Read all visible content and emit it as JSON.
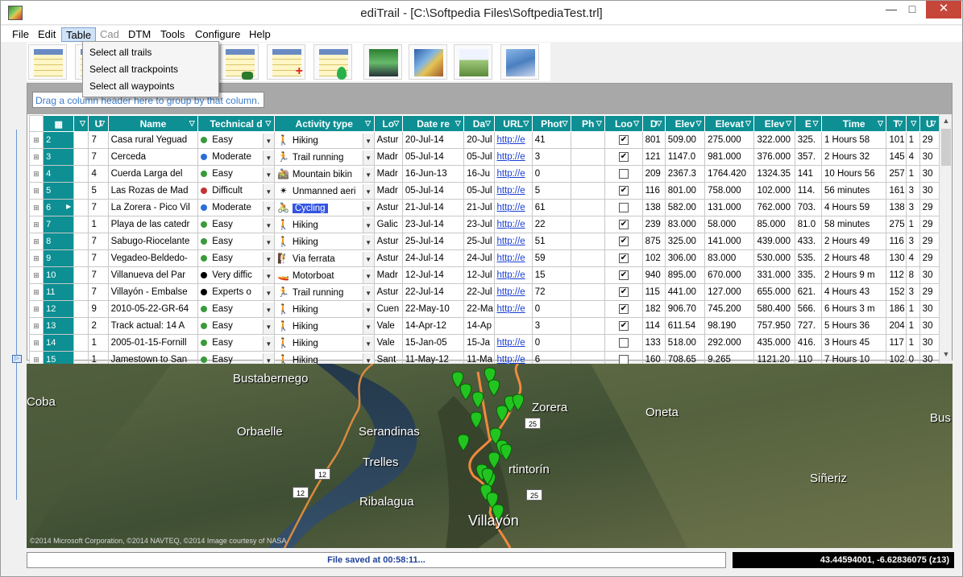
{
  "window": {
    "title": "ediTrail - [C:\\Softpedia Files\\SoftpediaTest.trl]",
    "min_label": "—",
    "max_label": "□",
    "close_label": "✕"
  },
  "menu": {
    "items": [
      {
        "label": "File",
        "state": "normal"
      },
      {
        "label": "Edit",
        "state": "normal"
      },
      {
        "label": "Table",
        "state": "open"
      },
      {
        "label": "Cad",
        "state": "disabled"
      },
      {
        "label": "DTM",
        "state": "normal"
      },
      {
        "label": "Tools",
        "state": "normal"
      },
      {
        "label": "Configure",
        "state": "normal"
      },
      {
        "label": "Help",
        "state": "normal"
      }
    ],
    "table_dropdown": [
      "Select all trails",
      "Select all trackpoints",
      "Select all waypoints"
    ]
  },
  "toolbar": {
    "buttons": [
      {
        "icon": "save-grid-icon"
      },
      {
        "icon": "table-grid-icon"
      },
      {
        "icon": "trail-grid-icon"
      },
      {
        "icon": "add-row-icon",
        "mark": "+"
      },
      {
        "icon": "waypoint-grid-icon"
      },
      {
        "icon": "gps-device-icon"
      },
      {
        "icon": "photos-icon"
      },
      {
        "icon": "elevation-profile-icon"
      },
      {
        "icon": "map-layers-icon"
      }
    ]
  },
  "grid": {
    "group_hint": "Drag a column header here to group by that column.",
    "columns": [
      "",
      "U",
      "Name",
      "Technical d",
      "Activity type",
      "Lo",
      "Date re",
      "Da",
      "URL",
      "Phot",
      "Ph",
      "Loo",
      "D",
      "Elev",
      "Elevat",
      "Elev",
      "E",
      "Time",
      "T",
      "",
      "U"
    ],
    "rows": [
      {
        "id": "2",
        "u": "7",
        "name": "Casa rural Yeguad",
        "tech": "Easy",
        "tech_color": "#3a9a3a",
        "act": "Hiking",
        "act_icon": "🚶",
        "loc": "Astur",
        "date": "20-Jul-14",
        "da": "20-Jul",
        "url": "http://e",
        "phot": "41",
        "ph": "",
        "loop": true,
        "d": "801",
        "elev1": "509.00",
        "elev2": "275.000",
        "elev3": "322.000",
        "e": "325.",
        "time": "1 Hours 58",
        "t": "101",
        "x": "1",
        "u2": "29"
      },
      {
        "id": "3",
        "u": "7",
        "name": "Cerceda",
        "tech": "Moderate",
        "tech_color": "#2b6fd6",
        "act": "Trail running",
        "act_icon": "🏃",
        "loc": "Madr",
        "date": "05-Jul-14",
        "da": "05-Jul",
        "url": "http://e",
        "phot": "3",
        "ph": "",
        "loop": true,
        "d": "121",
        "elev1": "1147.0",
        "elev2": "981.000",
        "elev3": "376.000",
        "e": "357.",
        "time": "2 Hours 32",
        "t": "145",
        "x": "4",
        "u2": "30"
      },
      {
        "id": "4",
        "u": "4",
        "name": "Cuerda Larga del",
        "tech": "Easy",
        "tech_color": "#3a9a3a",
        "act": "Mountain bikin",
        "act_icon": "🚵",
        "loc": "Madr",
        "date": "16-Jun-13",
        "da": "16-Ju",
        "url": "http://e",
        "phot": "0",
        "ph": "",
        "loop": false,
        "d": "209",
        "elev1": "2367.3",
        "elev2": "1764.420",
        "elev3": "1324.35",
        "e": "141",
        "time": "10 Hours 56",
        "t": "257",
        "x": "1",
        "u2": "30"
      },
      {
        "id": "5",
        "u": "5",
        "name": "Las Rozas de Mad",
        "tech": "Difficult",
        "tech_color": "#c43434",
        "act": "Unmanned aeri",
        "act_icon": "✴",
        "loc": "Madr",
        "date": "05-Jul-14",
        "da": "05-Jul",
        "url": "http://e",
        "phot": "5",
        "ph": "",
        "loop": true,
        "d": "116",
        "elev1": "801.00",
        "elev2": "758.000",
        "elev3": "102.000",
        "e": "114.",
        "time": "56 minutes",
        "t": "161",
        "x": "3",
        "u2": "30"
      },
      {
        "id": "6",
        "u": "7",
        "name": "La Zorera - Pico Vil",
        "tech": "Moderate",
        "tech_color": "#2b6fd6",
        "act": "Cycling",
        "act_icon": "🚴",
        "act_selected": true,
        "current": true,
        "loc": "Astur",
        "date": "21-Jul-14",
        "da": "21-Jul",
        "url": "http://e",
        "phot": "61",
        "ph": "",
        "loop": false,
        "d": "138",
        "elev1": "582.00",
        "elev2": "131.000",
        "elev3": "762.000",
        "e": "703.",
        "time": "4 Hours 59",
        "t": "138",
        "x": "3",
        "u2": "29"
      },
      {
        "id": "7",
        "u": "1",
        "name": "Playa de las catedr",
        "tech": "Easy",
        "tech_color": "#3a9a3a",
        "act": "Hiking",
        "act_icon": "🚶",
        "loc": "Galic",
        "date": "23-Jul-14",
        "da": "23-Jul",
        "url": "http://e",
        "phot": "22",
        "ph": "",
        "loop": true,
        "d": "239",
        "elev1": "83.000",
        "elev2": "58.000",
        "elev3": "85.000",
        "e": "81.0",
        "time": "58 minutes",
        "t": "275",
        "x": "1",
        "u2": "29"
      },
      {
        "id": "8",
        "u": "7",
        "name": "Sabugo-Riocelante",
        "tech": "Easy",
        "tech_color": "#3a9a3a",
        "act": "Hiking",
        "act_icon": "🚶",
        "loc": "Astur",
        "date": "25-Jul-14",
        "da": "25-Jul",
        "url": "http://e",
        "phot": "51",
        "ph": "",
        "loop": true,
        "d": "875",
        "elev1": "325.00",
        "elev2": "141.000",
        "elev3": "439.000",
        "e": "433.",
        "time": "2 Hours 49",
        "t": "116",
        "x": "3",
        "u2": "29"
      },
      {
        "id": "9",
        "u": "7",
        "name": "Vegadeo-Beldedo-",
        "tech": "Easy",
        "tech_color": "#3a9a3a",
        "act": "Via ferrata",
        "act_icon": "🧗",
        "loc": "Astur",
        "date": "24-Jul-14",
        "da": "24-Jul",
        "url": "http://e",
        "phot": "59",
        "ph": "",
        "loop": true,
        "d": "102",
        "elev1": "306.00",
        "elev2": "83.000",
        "elev3": "530.000",
        "e": "535.",
        "time": "2 Hours 48",
        "t": "130",
        "x": "4",
        "u2": "29"
      },
      {
        "id": "10",
        "u": "7",
        "name": "Villanueva del Par",
        "tech": "Very diffic",
        "tech_color": "#000000",
        "act": "Motorboat",
        "act_icon": "🚤",
        "loc": "Madr",
        "date": "12-Jul-14",
        "da": "12-Jul",
        "url": "http://e",
        "phot": "15",
        "ph": "",
        "loop": true,
        "d": "940",
        "elev1": "895.00",
        "elev2": "670.000",
        "elev3": "331.000",
        "e": "335.",
        "time": "2 Hours 9 m",
        "t": "112",
        "x": "8",
        "u2": "30"
      },
      {
        "id": "11",
        "u": "7",
        "name": "Villayón - Embalse",
        "tech": "Experts o",
        "tech_color": "#000000",
        "act": "Trail running",
        "act_icon": "🏃",
        "loc": "Astur",
        "date": "22-Jul-14",
        "da": "22-Jul",
        "url": "http://e",
        "phot": "72",
        "ph": "",
        "loop": true,
        "d": "115",
        "elev1": "441.00",
        "elev2": "127.000",
        "elev3": "655.000",
        "e": "621.",
        "time": "4 Hours 43",
        "t": "152",
        "x": "3",
        "u2": "29"
      },
      {
        "id": "12",
        "u": "9",
        "name": "2010-05-22-GR-64",
        "tech": "Easy",
        "tech_color": "#3a9a3a",
        "act": "Hiking",
        "act_icon": "🚶",
        "loc": "Cuen",
        "date": "22-May-10",
        "da": "22-Ma",
        "url": "http://e",
        "phot": "0",
        "ph": "",
        "loop": true,
        "d": "182",
        "elev1": "906.70",
        "elev2": "745.200",
        "elev3": "580.400",
        "e": "566.",
        "time": "6 Hours 3 m",
        "t": "186",
        "x": "1",
        "u2": "30"
      },
      {
        "id": "13",
        "u": "2",
        "name": "Track actual: 14 A",
        "tech": "Easy",
        "tech_color": "#3a9a3a",
        "act": "Hiking",
        "act_icon": "🚶",
        "loc": "Vale",
        "date": "14-Apr-12",
        "da": "14-Ap",
        "url": "",
        "phot": "3",
        "ph": "",
        "loop": true,
        "d": "114",
        "elev1": "611.54",
        "elev2": "98.190",
        "elev3": "757.950",
        "e": "727.",
        "time": "5 Hours 36",
        "t": "204",
        "x": "1",
        "u2": "30"
      },
      {
        "id": "14",
        "u": "1",
        "name": "2005-01-15-Fornill",
        "tech": "Easy",
        "tech_color": "#3a9a3a",
        "act": "Hiking",
        "act_icon": "🚶",
        "loc": "Vale",
        "date": "15-Jan-05",
        "da": "15-Ja",
        "url": "http://e",
        "phot": "0",
        "ph": "",
        "loop": false,
        "d": "133",
        "elev1": "518.00",
        "elev2": "292.000",
        "elev3": "435.000",
        "e": "416.",
        "time": "3 Hours 45",
        "t": "117",
        "x": "1",
        "u2": "30"
      },
      {
        "id": "15",
        "u": "1",
        "name": "Jamestown to San",
        "tech": "Easy",
        "tech_color": "#3a9a3a",
        "act": "Hiking",
        "act_icon": "🚶",
        "loc": "Sant",
        "date": "11-May-12",
        "da": "11-Ma",
        "url": "http://e",
        "phot": "6",
        "ph": "",
        "loop": false,
        "d": "160",
        "elev1": "708.65",
        "elev2": "9.265",
        "elev3": "1121.20",
        "e": "110",
        "time": "7 Hours 10",
        "t": "102",
        "x": "0",
        "u2": "30"
      }
    ]
  },
  "map": {
    "labels": [
      {
        "text": "Bustabernego"
      },
      {
        "text": "Coba"
      },
      {
        "text": "Orbaelle"
      },
      {
        "text": "Serandinas"
      },
      {
        "text": "Trelles"
      },
      {
        "text": "Ribalagua"
      },
      {
        "text": "Zorera"
      },
      {
        "text": "Oneta"
      },
      {
        "text": "Bus"
      },
      {
        "text": "rtintorín"
      },
      {
        "text": "Siñeriz"
      },
      {
        "text": "Villayón"
      }
    ],
    "road_shields": [
      "12",
      "12",
      "25",
      "25"
    ],
    "copyright": "©2014 Microsoft Corporation, ©2014 NAVTEQ, ©2014 Image courtesy of NASA"
  },
  "status": {
    "message": "File saved at 00:58:11...",
    "coords": "43.44594001, -6.62836075 (z13)"
  },
  "colors": {
    "header_teal": "#0d8f93",
    "selection_blue": "#3354e2",
    "waypoint_green": "#22c41f",
    "track_orange": "#e67e35"
  }
}
